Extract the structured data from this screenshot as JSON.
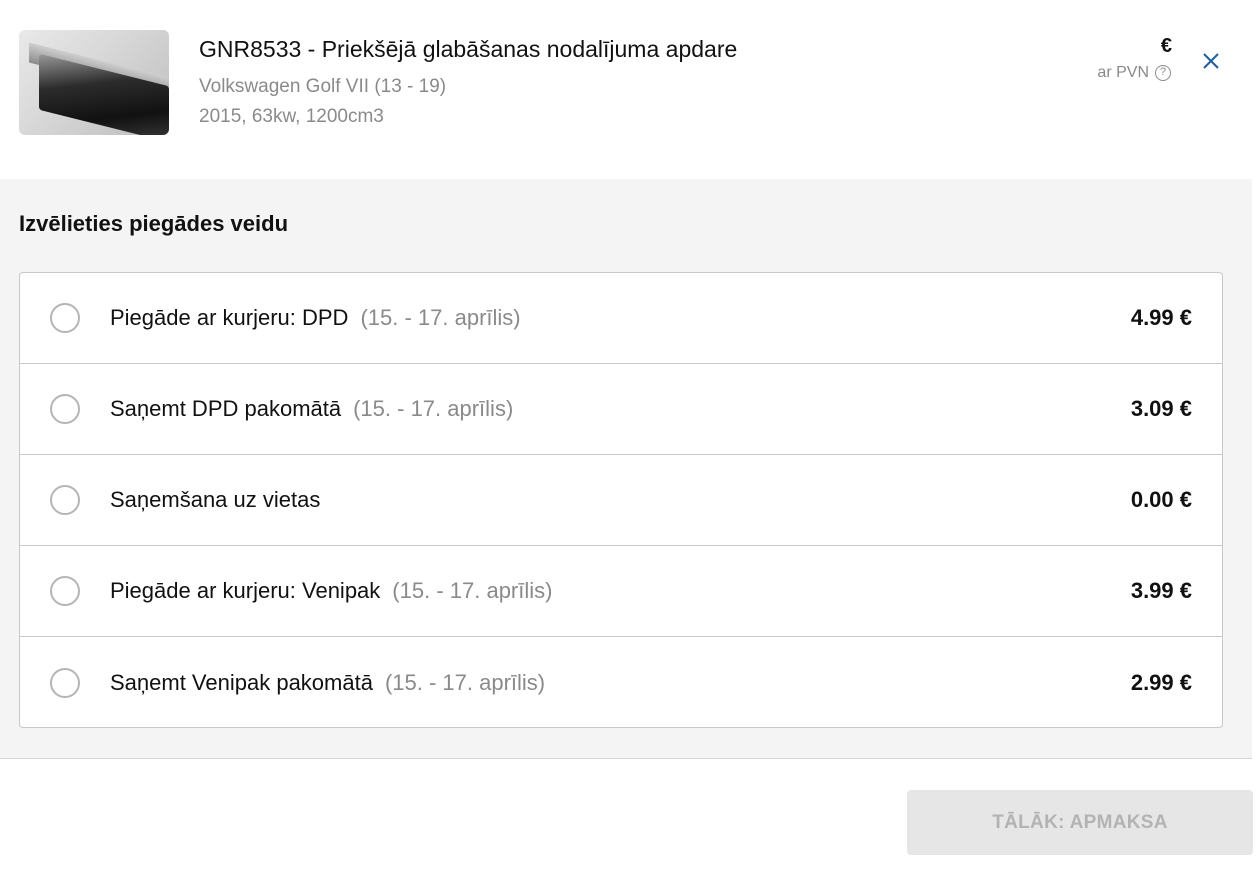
{
  "product": {
    "title": "GNR8533 - Priekšējā glabāšanas nodalījuma apdare",
    "vehicle": "Volkswagen Golf VII (13 - 19)",
    "details": "2015, 63kw, 1200cm3",
    "currency_symbol": "€",
    "vat_label": "ar PVN",
    "help_icon": "?"
  },
  "delivery": {
    "heading": "Izvēlieties piegādes veidu",
    "options": [
      {
        "label": "Piegāde ar kurjeru: DPD",
        "date": "(15. - 17. aprīlis)",
        "price": "4.99 €"
      },
      {
        "label": "Saņemt DPD pakomātā",
        "date": "(15. - 17. aprīlis)",
        "price": "3.09 €"
      },
      {
        "label": "Saņemšana uz vietas",
        "date": "",
        "price": "0.00 €"
      },
      {
        "label": "Piegāde ar kurjeru: Venipak",
        "date": "(15. - 17. aprīlis)",
        "price": "3.99 €"
      },
      {
        "label": "Saņemt Venipak pakomātā",
        "date": "(15. - 17. aprīlis)",
        "price": "2.99 €"
      }
    ]
  },
  "footer": {
    "next_button": "TĀLĀK: APMAKSA"
  },
  "colors": {
    "accent_close": "#1f5fa0",
    "panel_bg": "#f4f4f4",
    "disabled_button_bg": "#e6e6e6",
    "disabled_button_text": "#b3b3b3"
  }
}
